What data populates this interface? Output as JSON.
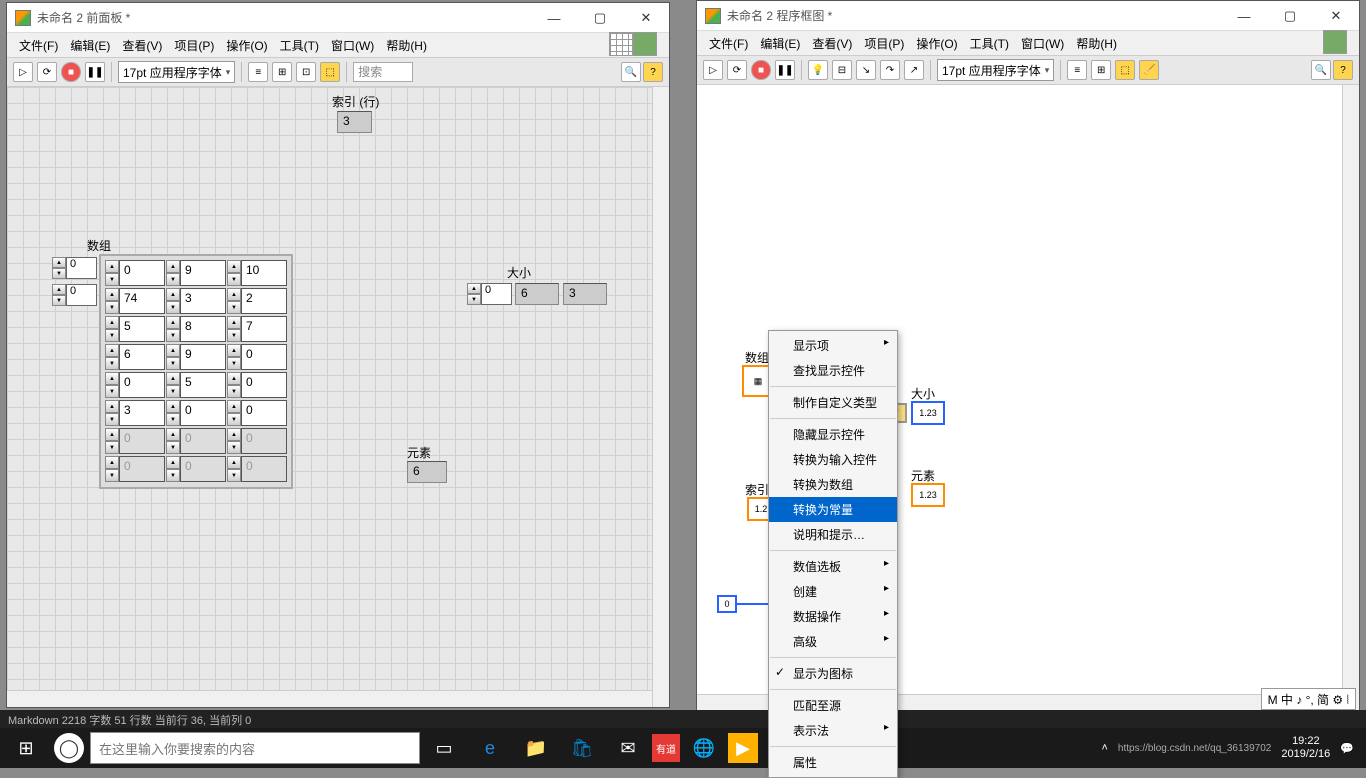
{
  "front": {
    "title": "未命名 2 前面板 *",
    "menus": [
      "文件(F)",
      "编辑(E)",
      "查看(V)",
      "项目(P)",
      "操作(O)",
      "工具(T)",
      "窗口(W)",
      "帮助(H)"
    ],
    "font": "17pt 应用程序字体",
    "search_placeholder": "搜索",
    "labels": {
      "index_row": "索引 (行)",
      "array": "数组",
      "size": "大小",
      "element": "元素"
    },
    "index_value": "3",
    "idx_outer": [
      "0",
      "0"
    ],
    "size_idx": "0",
    "size_vals": [
      "6",
      "3"
    ],
    "element_val": "6",
    "array_data": [
      [
        "0",
        "9",
        "10"
      ],
      [
        "74",
        "3",
        "2"
      ],
      [
        "5",
        "8",
        "7"
      ],
      [
        "6",
        "9",
        "0"
      ],
      [
        "0",
        "5",
        "0"
      ],
      [
        "3",
        "0",
        "0"
      ],
      [
        "0",
        "0",
        "0"
      ],
      [
        "0",
        "0",
        "0"
      ]
    ]
  },
  "block": {
    "title": "未命名 2 程序框图 *",
    "menus": [
      "文件(F)",
      "编辑(E)",
      "查看(V)",
      "项目(P)",
      "操作(O)",
      "工具(T)",
      "窗口(W)",
      "帮助(H)"
    ],
    "font": "17pt 应用程序字体",
    "labels": {
      "array": "数组",
      "size": "大小",
      "element": "元素",
      "index": "索引"
    },
    "node_text": "1.23",
    "const0": "0"
  },
  "ctx_menu": {
    "items": [
      {
        "t": "显示项",
        "arrow": true
      },
      {
        "t": "查找显示控件"
      },
      {
        "sep": true
      },
      {
        "t": "制作自定义类型"
      },
      {
        "sep": true
      },
      {
        "t": "隐藏显示控件"
      },
      {
        "t": "转换为输入控件"
      },
      {
        "t": "转换为数组"
      },
      {
        "t": "转换为常量",
        "sel": true
      },
      {
        "t": "说明和提示…"
      },
      {
        "sep": true
      },
      {
        "t": "数值选板",
        "arrow": true
      },
      {
        "t": "创建",
        "arrow": true
      },
      {
        "t": "数据操作",
        "arrow": true
      },
      {
        "t": "高级",
        "arrow": true
      },
      {
        "sep": true
      },
      {
        "t": "显示为图标",
        "check": true
      },
      {
        "sep": true
      },
      {
        "t": "匹配至源"
      },
      {
        "t": "表示法",
        "arrow": true
      },
      {
        "sep": true
      },
      {
        "t": "属性"
      }
    ]
  },
  "status_line": "Markdown  2218 字数  51 行数  当前行 36, 当前列 0",
  "watermark": "https://blog.csdn.net/qq_36139702",
  "ime": "M 中 ♪ °, 简 ⚙ ⦚",
  "taskbar": {
    "search": "在这里输入你要搜索的内容",
    "time": "19:22",
    "date": "2019/2/16"
  }
}
